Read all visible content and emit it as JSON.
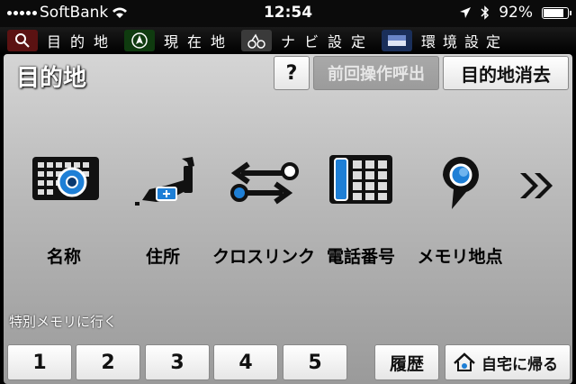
{
  "status": {
    "carrier": "SoftBank",
    "time": "12:54",
    "battery": "92%",
    "battery_level": 0.92
  },
  "tabs": [
    {
      "label": "目的地",
      "icon": "search-icon"
    },
    {
      "label": "現在地",
      "icon": "location-arrow-icon"
    },
    {
      "label": "ナビ設定",
      "icon": "car-icon"
    },
    {
      "label": "環境設定",
      "icon": "screen-icon"
    }
  ],
  "header": {
    "title": "目的地",
    "help_label": "?",
    "recall_label": "前回操作呼出",
    "clear_label": "目的地消去"
  },
  "categories": [
    {
      "label": "名称",
      "icon": "keyboard-icon"
    },
    {
      "label": "住所",
      "icon": "japan-map-icon"
    },
    {
      "label": "クロスリンク",
      "icon": "crosslink-icon"
    },
    {
      "label": "電話番号",
      "icon": "phone-keypad-icon"
    },
    {
      "label": "メモリ地点",
      "icon": "map-pin-icon"
    }
  ],
  "memory": {
    "label": "特別メモリに行く",
    "buttons": [
      "1",
      "2",
      "3",
      "4",
      "5"
    ],
    "history_label": "履歴",
    "home_label": "自宅に帰る"
  },
  "colors": {
    "accent_blue": "#1e7fd6",
    "panel": "#b8b8b8"
  }
}
